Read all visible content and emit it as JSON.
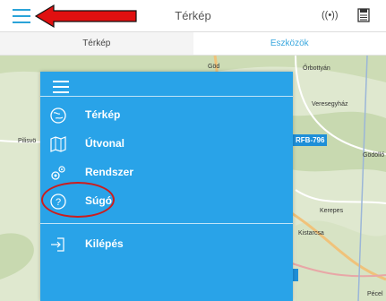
{
  "header": {
    "title": "Térkép"
  },
  "tabs": [
    {
      "label": "Térkép",
      "active": true
    },
    {
      "label": "Eszközök",
      "active": false
    }
  ],
  "map": {
    "place_labels": [
      "Őrbottyán",
      "Veresegyház",
      "Pilisvö",
      "Göd",
      "Gödöllő",
      "Kerepes",
      "Kistarcsa",
      "Pécel"
    ],
    "vehicle_plate": "RFB-796"
  },
  "menu": {
    "items": [
      {
        "label": "Térkép",
        "icon": "map-icon"
      },
      {
        "label": "Útvonal",
        "icon": "route-icon"
      },
      {
        "label": "Rendszer",
        "icon": "gears-icon"
      },
      {
        "label": "Súgó",
        "icon": "help-icon"
      }
    ],
    "logout": {
      "label": "Kilépés",
      "icon": "logout-icon"
    }
  },
  "colors": {
    "accent": "#2aa3d8",
    "menu_bg": "#29a3e8",
    "annotation": "#cc1d1d"
  }
}
